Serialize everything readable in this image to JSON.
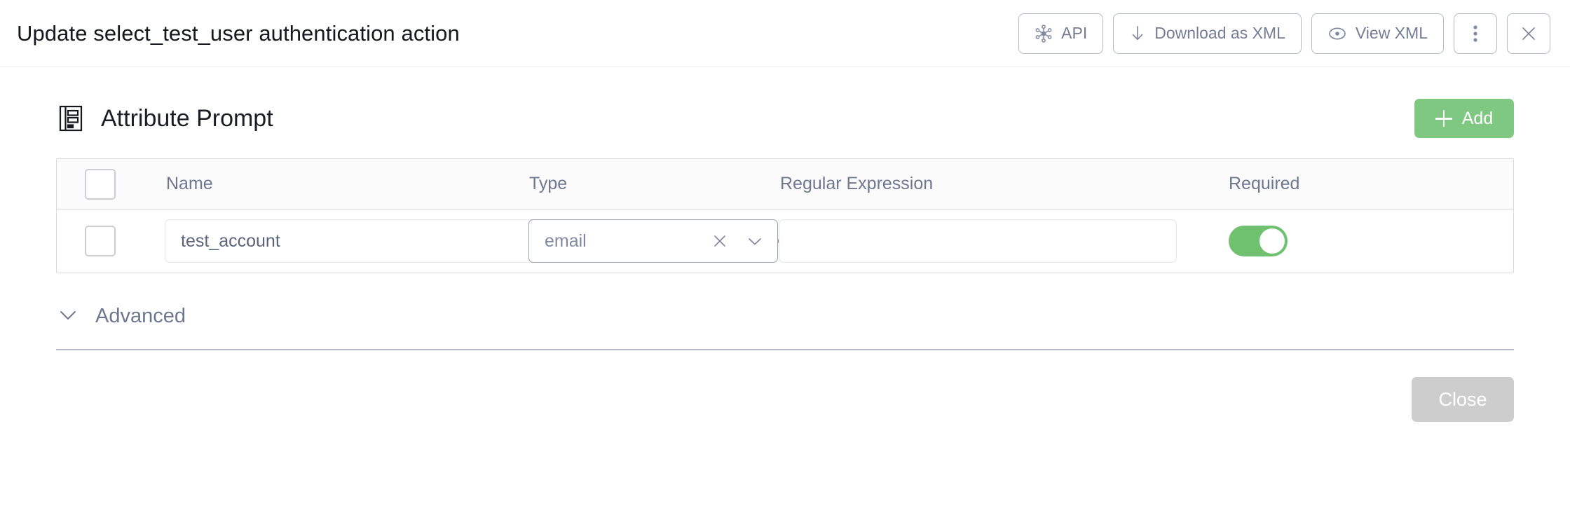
{
  "header": {
    "title": "Update select_test_user authentication action",
    "actions": [
      {
        "label": "API",
        "icon": "api-hub-icon",
        "name": "api-button"
      },
      {
        "label": "Download as XML",
        "icon": "download-arrow-icon",
        "name": "download-xml-button"
      },
      {
        "label": "View XML",
        "icon": "eye-icon",
        "name": "view-xml-button"
      },
      {
        "label": "",
        "icon": "kebab-menu-icon",
        "name": "more-options-button"
      },
      {
        "label": "",
        "icon": "close-icon",
        "name": "close-dialog-button"
      }
    ]
  },
  "section": {
    "title": "Attribute Prompt",
    "icon": "form-document-icon",
    "add_label": "Add"
  },
  "table": {
    "columns": [
      "Name",
      "Type",
      "Regular Expression",
      "Required"
    ],
    "rows": [
      {
        "name_value": "test_account",
        "name_placeholder": "",
        "type_value": "email",
        "regex_value": "",
        "regex_placeholder": "",
        "required": true
      }
    ]
  },
  "advanced": {
    "label": "Advanced",
    "expanded": false
  },
  "footer": {
    "close_label": "Close"
  },
  "colors": {
    "accent_green": "#7fc882",
    "toggle_on": "#6fc06f",
    "muted_text": "#6e7790",
    "border": "#d7dae0",
    "disabled_button": "#cdcdcd"
  }
}
